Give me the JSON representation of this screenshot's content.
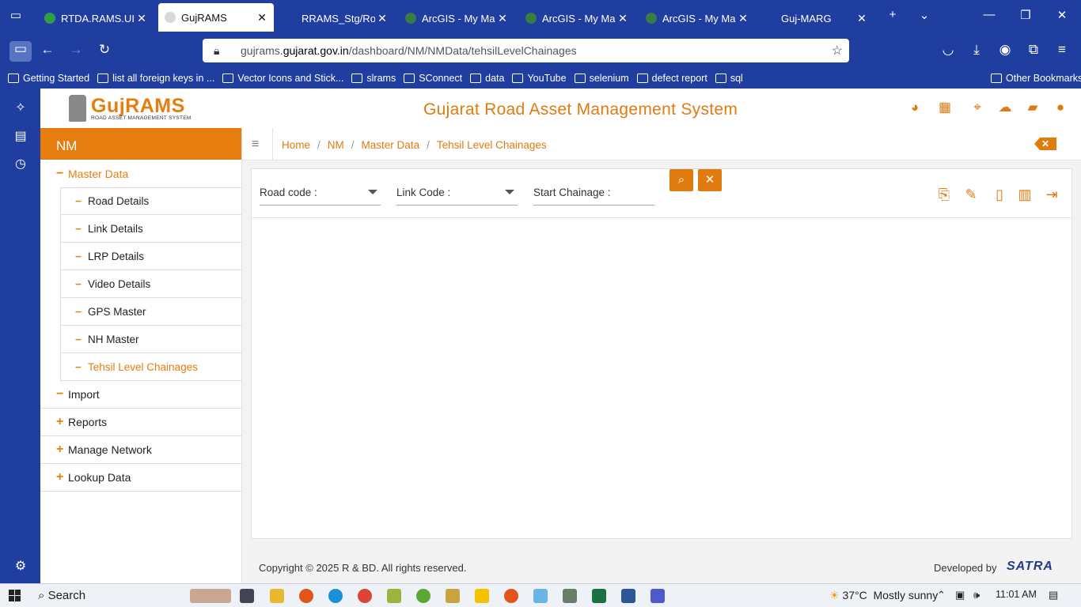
{
  "browser": {
    "tabs": [
      {
        "label": "RTDA.RAMS.UI",
        "color": "#2ea043",
        "active": false
      },
      {
        "label": "GujRAMS",
        "color": "#d9d9d9",
        "active": true
      },
      {
        "label": "RRAMS_Stg/RoadInve",
        "color": "#1f3ea0",
        "active": false
      },
      {
        "label": "ArcGIS - My Map",
        "color": "#3a7d44",
        "active": false
      },
      {
        "label": "ArcGIS - My Map",
        "color": "#3a7d44",
        "active": false
      },
      {
        "label": "ArcGIS - My Map",
        "color": "#3a7d44",
        "active": false
      },
      {
        "label": "Guj-MARG",
        "color": "#1f3ea0",
        "active": false
      }
    ],
    "url_prefix": "gujrams.",
    "url_host": "gujarat.gov.in",
    "url_path": "/dashboard/NM/NMData/tehsilLevelChainages",
    "bookmarks": [
      "Getting Started",
      "list all foreign keys in ...",
      "Vector Icons and Stick...",
      "slrams",
      "SConnect",
      "data",
      "YouTube",
      "selenium",
      "defect report",
      "sql"
    ],
    "other_bookmarks": "Other Bookmarks"
  },
  "app": {
    "logo_name": "GujRAMS",
    "logo_sub": "ROAD ASSET MANAGEMENT SYSTEM",
    "title": "Gujarat Road Asset Management System",
    "header_icons": [
      "palette-icon",
      "grid-icon",
      "map-icon",
      "cloud-download-icon",
      "book-icon",
      "user-icon"
    ],
    "accent": "#e67e0f"
  },
  "leftnav": {
    "module": "NM",
    "master_data": "Master Data",
    "sub_items": [
      "Road Details",
      "Link Details",
      "LRP Details",
      "Video Details",
      "GPS Master",
      "NH Master",
      "Tehsil Level Chainages"
    ],
    "sections": [
      {
        "label": "Import",
        "sym": "−"
      },
      {
        "label": "Reports",
        "sym": "+"
      },
      {
        "label": "Manage Network",
        "sym": "+"
      },
      {
        "label": "Lookup Data",
        "sym": "+"
      }
    ]
  },
  "breadcrumb": [
    "Home",
    "NM",
    "Master Data",
    "Tehsil Level Chainages"
  ],
  "filters": {
    "road_code": "Road code :",
    "link_code": "Link Code :",
    "start_chainage": "Start Chainage :"
  },
  "footer": {
    "copyright": "Copyright © 2025 R & BD. All rights reserved.",
    "developed_by": "Developed by",
    "developer": "SATRA"
  },
  "taskbar": {
    "search": "Search",
    "temperature": "37°C",
    "weather": "Mostly sunny",
    "time": "11:01 AM"
  }
}
